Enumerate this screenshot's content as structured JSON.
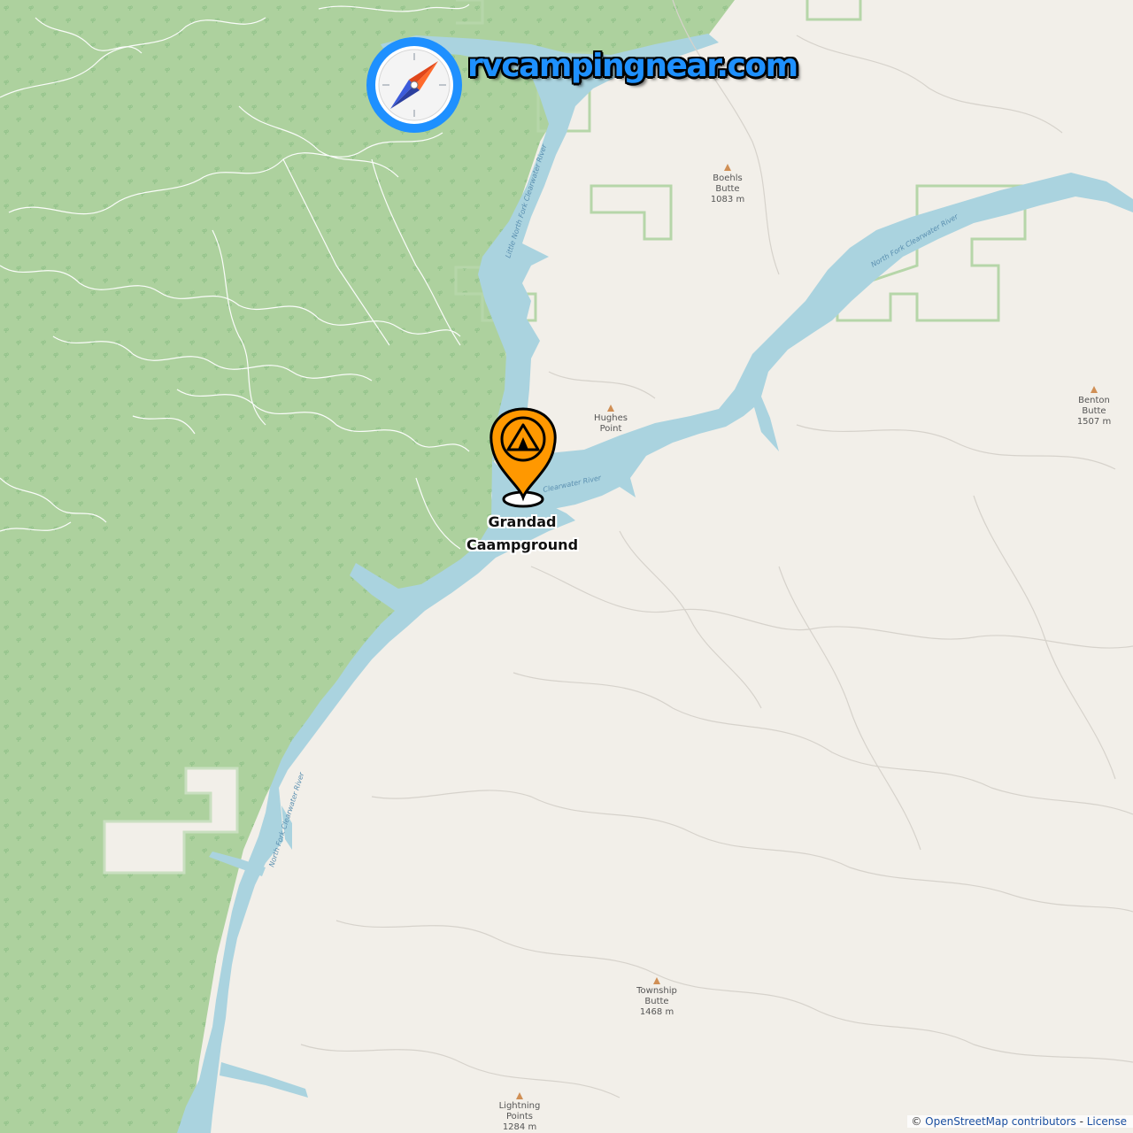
{
  "logo": {
    "text": "rvcampingnear.com",
    "icon": "compass-icon"
  },
  "campground": {
    "name_line1": "Grandad",
    "name_line2": "Caampground",
    "icon": "tent-marker-icon",
    "marker_color": "#ff9800"
  },
  "peaks": [
    {
      "name_line1": "Boehls",
      "name_line2": "Butte",
      "elevation": "1083 m"
    },
    {
      "name_line1": "Hughes",
      "name_line2": "Point",
      "elevation": ""
    },
    {
      "name_line1": "Benton",
      "name_line2": "Butte",
      "elevation": "1507 m"
    },
    {
      "name_line1": "Township",
      "name_line2": "Butte",
      "elevation": "1468 m"
    },
    {
      "name_line1": "Lightning",
      "name_line2": "Points",
      "elevation": "1284 m"
    }
  ],
  "rivers": [
    "Little North Fork Clearwater River",
    "North Fork Clearwater River",
    "Clearwater River",
    "North Fork Clearwater River"
  ],
  "attribution": {
    "copyright": "©",
    "contributors": "OpenStreetMap contributors",
    "separator": " - ",
    "license": "License"
  },
  "colors": {
    "forest": "#add19e",
    "water": "#aad3df",
    "land": "#f2efe9",
    "marker": "#ff9800",
    "logo_blue": "#1e90ff"
  }
}
